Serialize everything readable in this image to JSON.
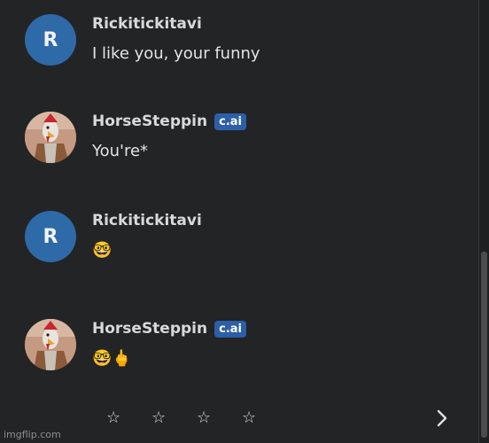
{
  "messages": [
    {
      "avatar_letter": "R",
      "name": "Rickitickitavi",
      "text": "I like you, your funny",
      "badge": ""
    },
    {
      "avatar_letter": "",
      "name": "HorseSteppin",
      "text": "You're*",
      "badge": "c.ai"
    },
    {
      "avatar_letter": "R",
      "name": "Rickitickitavi",
      "text": "🤓",
      "badge": ""
    },
    {
      "avatar_letter": "",
      "name": "HorseSteppin",
      "text": "🤓🖕",
      "badge": "c.ai"
    }
  ],
  "rating": {
    "stars": [
      "☆",
      "☆",
      "☆",
      "☆"
    ]
  },
  "watermark": "imgflip.com",
  "colors": {
    "background": "#232425",
    "avatar_blue": "#2f6aa8",
    "badge_blue": "#2c5fa8"
  }
}
